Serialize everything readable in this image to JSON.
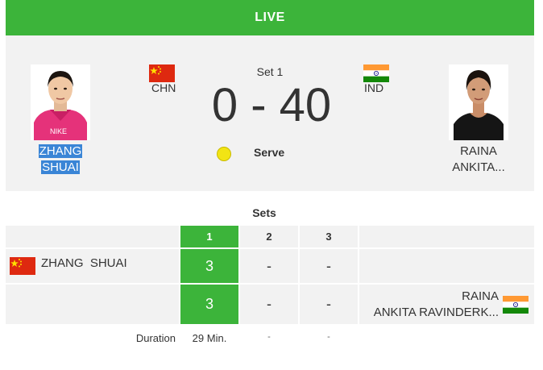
{
  "status": "LIVE",
  "set_label": "Set 1",
  "score": {
    "home": "0",
    "separator": "-",
    "away": "40"
  },
  "serve_label": "Serve",
  "players": {
    "home": {
      "name_line1": "ZHANG",
      "name_line2": "SHUAI",
      "country": "CHN",
      "flag": "china-flag"
    },
    "away": {
      "name_line1": "RAINA",
      "name_line2": "ANKITA...",
      "country": "IND",
      "flag": "india-flag"
    }
  },
  "sets_table": {
    "title": "Sets",
    "columns": [
      "1",
      "2",
      "3"
    ],
    "rows": [
      {
        "name": "ZHANG  SHUAI",
        "scores": [
          "3",
          "-",
          "-"
        ]
      },
      {
        "name_line1": "RAINA",
        "name_line2": "ANKITA RAVINDERK...",
        "scores": [
          "3",
          "-",
          "-"
        ]
      }
    ],
    "duration_label": "Duration",
    "durations": [
      "29 Min.",
      "-",
      "-"
    ]
  },
  "colors": {
    "live_green": "#3cb43a",
    "panel_gray": "#f2f2f2",
    "text": "#333333",
    "highlight_blue": "#3a85d6",
    "ball_yellow": "#f2e414"
  }
}
